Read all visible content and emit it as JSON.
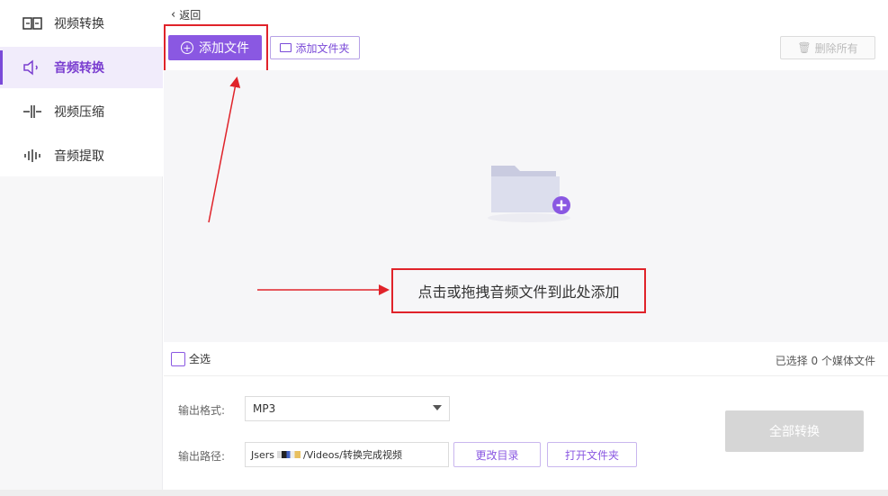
{
  "sidebar": {
    "items": [
      {
        "label": "视频转换",
        "icon": "video-convert-icon"
      },
      {
        "label": "音频转换",
        "icon": "audio-convert-icon",
        "active": true
      },
      {
        "label": "视频压缩",
        "icon": "video-compress-icon"
      },
      {
        "label": "音频提取",
        "icon": "audio-extract-icon"
      }
    ]
  },
  "header": {
    "back_label": "返回"
  },
  "toolbar": {
    "add_file_label": "添加文件",
    "add_folder_label": "添加文件夹",
    "delete_all_label": "删除所有"
  },
  "dropzone": {
    "hint": "点击或拖拽音频文件到此处添加"
  },
  "selection": {
    "select_all_label": "全选",
    "selected_count": "已选择 0 个媒体文件"
  },
  "settings": {
    "format_label": "输出格式:",
    "format_value": "MP3",
    "path_label": "输出路径:",
    "path_value_prefix": "Jsers",
    "path_value_suffix": "/Videos/转换完成视频",
    "change_dir_label": "更改目录",
    "open_folder_label": "打开文件夹",
    "convert_all_label": "全部转换"
  },
  "colors": {
    "accent": "#8a58e2",
    "annotation": "#e0232a",
    "disabled": "#d6d6d6"
  }
}
